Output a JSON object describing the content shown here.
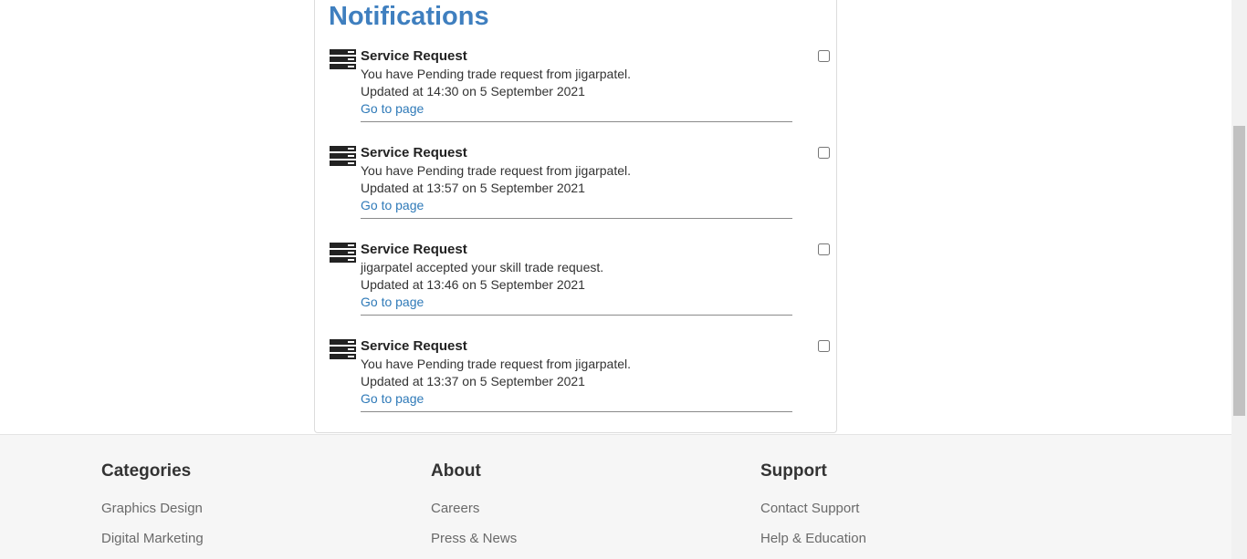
{
  "card": {
    "title": "Notifications"
  },
  "notifications": [
    {
      "title": "Service Request",
      "message": "You have Pending trade request from jigarpatel.",
      "updated": "Updated at 14:30 on 5 September 2021",
      "link_label": "Go to page",
      "icon": "server-icon",
      "checked": false
    },
    {
      "title": "Service Request",
      "message": "You have Pending trade request from jigarpatel.",
      "updated": "Updated at 13:57 on 5 September 2021",
      "link_label": "Go to page",
      "icon": "server-icon",
      "checked": false
    },
    {
      "title": "Service Request",
      "message": "jigarpatel accepted your skill trade request.",
      "updated": "Updated at 13:46 on 5 September 2021",
      "link_label": "Go to page",
      "icon": "server-icon",
      "checked": false
    },
    {
      "title": "Service Request",
      "message": "You have Pending trade request from jigarpatel.",
      "updated": "Updated at 13:37 on 5 September 2021",
      "link_label": "Go to page",
      "icon": "server-icon",
      "checked": false
    }
  ],
  "footer": {
    "categories": {
      "heading": "Categories",
      "links": [
        "Graphics Design",
        "Digital Marketing"
      ]
    },
    "about": {
      "heading": "About",
      "links": [
        "Careers",
        "Press & News"
      ]
    },
    "support": {
      "heading": "Support",
      "links": [
        "Contact Support",
        "Help & Education"
      ]
    }
  },
  "colors": {
    "title_blue": "#3f7fbf",
    "link_blue": "#2f7ab8",
    "footer_bg": "#f6f6f6"
  }
}
